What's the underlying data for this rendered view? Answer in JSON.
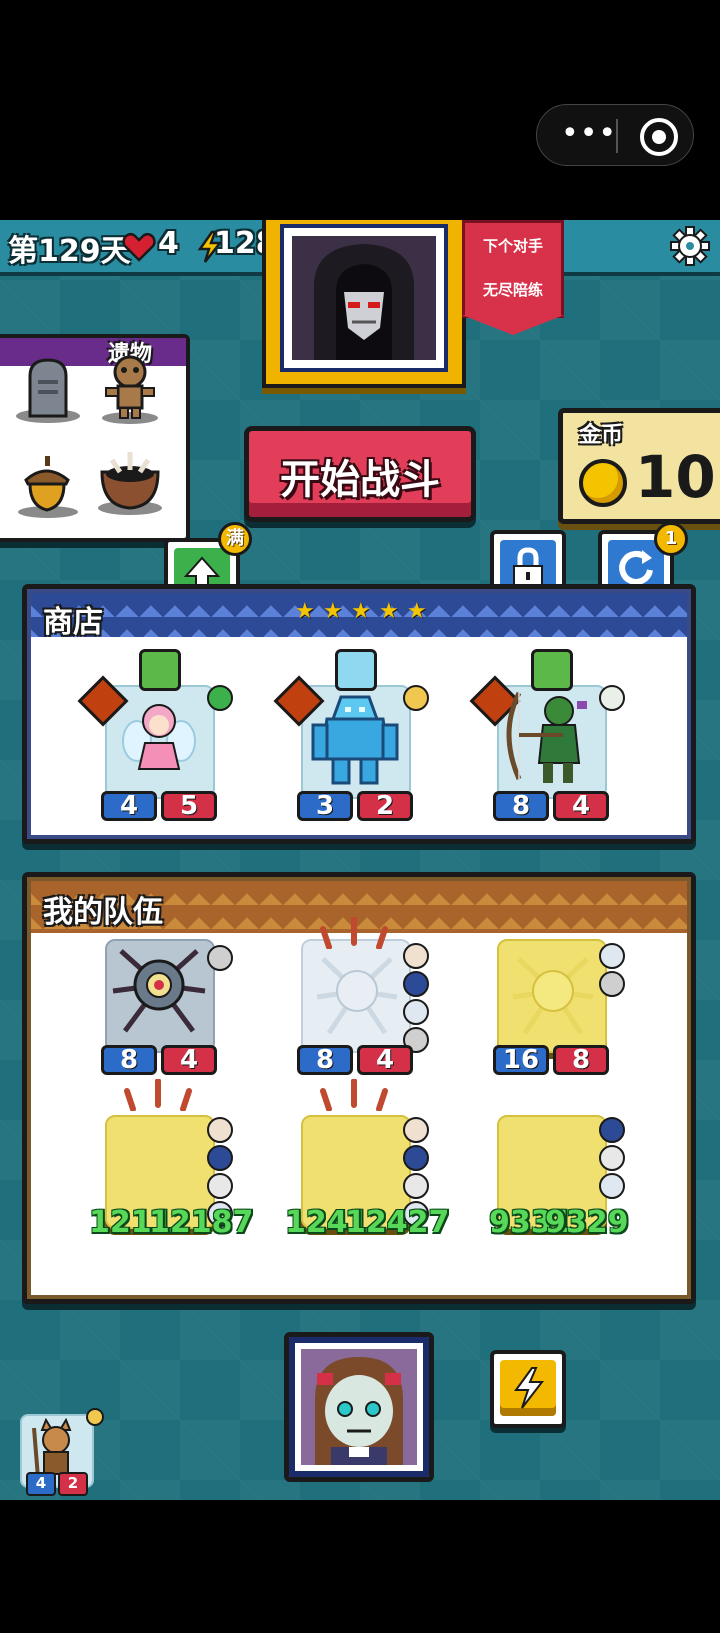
{
  "capsule": {
    "more_icon": "more-dots-icon",
    "close_icon": "target-circle-icon"
  },
  "topbar": {
    "day": "第129天",
    "lives": "4",
    "energy": "128"
  },
  "opponent": {
    "banner_line1": "下个对手",
    "banner_line2": "无尽陪练"
  },
  "items": {
    "label": "遗物"
  },
  "start_button": "开始战斗",
  "gold": {
    "label": "金币",
    "value": "10"
  },
  "upgrade": {
    "badge": "满"
  },
  "refresh": {
    "badge": "1"
  },
  "shop": {
    "title": "商店",
    "stars": [
      "★",
      "★",
      "★",
      "★",
      "★"
    ],
    "units": [
      {
        "atk": "4",
        "hp": "5"
      },
      {
        "atk": "3",
        "hp": "2"
      },
      {
        "atk": "8",
        "hp": "4"
      }
    ]
  },
  "team": {
    "title": "我的队伍",
    "row1": [
      {
        "atk": "8",
        "hp": "4"
      },
      {
        "atk": "8",
        "hp": "4"
      },
      {
        "atk": "16",
        "hp": "8"
      }
    ],
    "row2": [
      {
        "atk": "1211",
        "hp": "12187"
      },
      {
        "atk": "1241",
        "hp": "12427"
      },
      {
        "atk": "9331",
        "hp": "9329"
      }
    ]
  },
  "bench": {
    "atk": "4",
    "hp": "2"
  },
  "colors": {
    "background": "#1f6f7d",
    "start": "#e23e5a",
    "gold": "#f5c400",
    "atk": "#2c6cc8",
    "hp": "#d43048"
  }
}
